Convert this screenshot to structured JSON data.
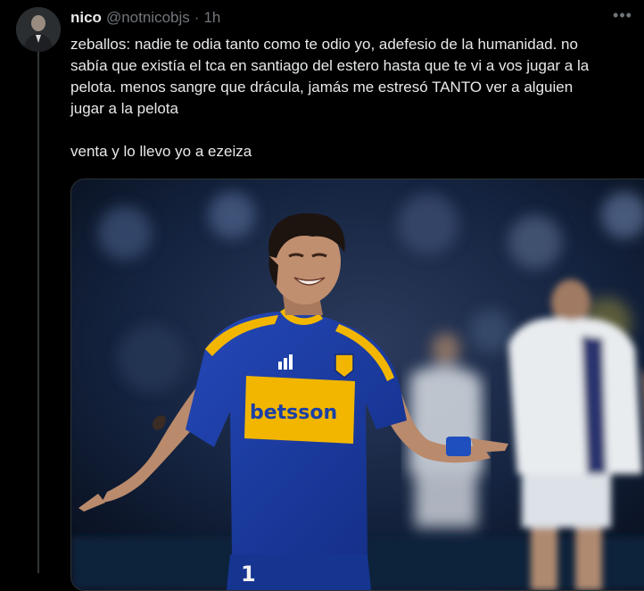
{
  "tweet": {
    "display_name": "nico",
    "handle": "@notnicobjs",
    "separator": "·",
    "time": "1h",
    "more_label": "•••",
    "text_lines": [
      "zeballos: nadie te odia tanto como te odio yo, adefesio de la humanidad. no",
      "sabía que existía el tca en santiago del estero hasta que te vi a vos jugar a la",
      "pelota. menos sangre que drácula, jamás me estresó TANTO ver a alguien",
      "jugar a la pelota",
      "",
      "venta y lo llevo yo a ezeiza"
    ],
    "media": {
      "shirt_sponsor": "betsson",
      "shirt_number": "1",
      "colors": {
        "shirt_blue": "#1b3fa6",
        "shirt_gold": "#f2b600",
        "opponent_white": "#e9ecef"
      }
    }
  }
}
